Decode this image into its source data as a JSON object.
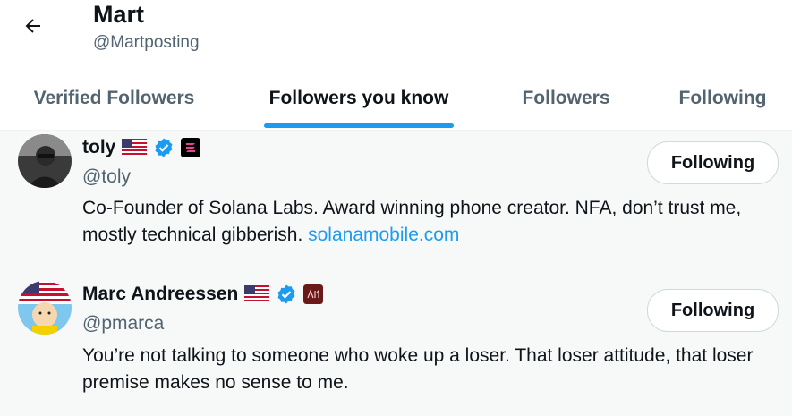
{
  "header": {
    "title": "Mart",
    "handle": "@Martposting",
    "back_icon": "arrow-left-icon"
  },
  "tabs": [
    {
      "label": "Verified Followers",
      "active": false
    },
    {
      "label": "Followers you know",
      "active": true
    },
    {
      "label": "Followers",
      "active": false
    },
    {
      "label": "Following",
      "active": false
    }
  ],
  "users": [
    {
      "name": "toly",
      "handle": "@toly",
      "badges": [
        "us-flag-icon",
        "verified-badge-icon",
        "solana-affiliate-icon"
      ],
      "button": "Following",
      "bio_text": "Co-Founder of Solana Labs. Award winning phone creator. NFA, don’t trust me, mostly technical gibberish.",
      "bio_link": "solanamobile.com"
    },
    {
      "name": "Marc Andreessen",
      "handle": "@pmarca",
      "badges": [
        "us-flag-icon",
        "verified-badge-icon",
        "a16z-affiliate-icon"
      ],
      "button": "Following",
      "bio_text": "You’re not talking to someone who woke up a loser. That loser attitude, that loser premise makes no sense to me.",
      "bio_link": ""
    }
  ],
  "colors": {
    "accent": "#1d9bf0",
    "text_primary": "#0f1419",
    "text_secondary": "#536471",
    "row_bg": "#f7f9f9"
  }
}
